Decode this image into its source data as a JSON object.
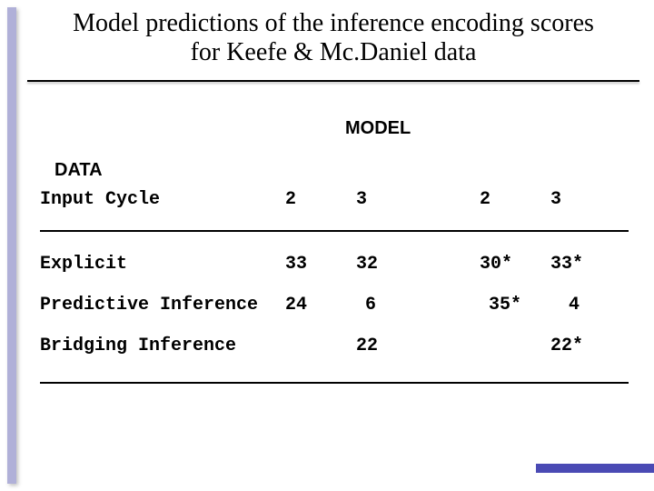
{
  "title_line1": "Model predictions of the inference encoding scores",
  "title_line2": "for Keefe & Mc.Daniel data",
  "labels": {
    "model": "MODEL",
    "data": "DATA"
  },
  "chart_data": {
    "type": "table",
    "title": "Model predictions of the inference encoding scores for Keefe & Mc.Daniel data",
    "column_groups": [
      "MODEL",
      "DATA"
    ],
    "header_row_label": "Input Cycle",
    "columns": [
      "2",
      "3",
      "2",
      "3"
    ],
    "rows": [
      {
        "label": "Explicit",
        "values": [
          "33",
          "32",
          "30*",
          "33*"
        ]
      },
      {
        "label": "Predictive Inference",
        "values": [
          "24",
          "6",
          "35*",
          "4"
        ]
      },
      {
        "label": "Bridging Inference",
        "values": [
          "",
          "22",
          "",
          "22*"
        ]
      }
    ]
  }
}
